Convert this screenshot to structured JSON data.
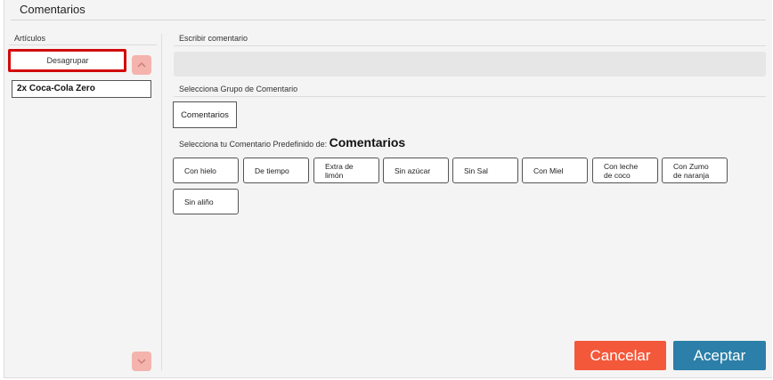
{
  "window": {
    "title": "Comentarios"
  },
  "left_panel": {
    "section_label": "Artículos",
    "ungroup_label": "Desagrupar",
    "articles": [
      {
        "label": "2x Coca-Cola Zero"
      }
    ],
    "scroll_up_icon": "chevron-up-icon",
    "scroll_down_icon": "chevron-down-icon"
  },
  "right_panel": {
    "write_label": "Escribir comentario",
    "comment_value": "",
    "group_label": "Selecciona Grupo de Comentario",
    "groups": [
      {
        "label": "Comentarios"
      }
    ],
    "predef_label": "Selecciona tu Comentario Predefinido de:",
    "predef_group": "Comentarios",
    "chips": [
      {
        "label": "Con hielo"
      },
      {
        "label": "De tiempo"
      },
      {
        "label": "Extra de\nlimón"
      },
      {
        "label": "Sin azúcar"
      },
      {
        "label": "Sin Sal"
      },
      {
        "label": "Con Miel"
      },
      {
        "label": "Con leche\nde coco"
      },
      {
        "label": "Con Zumo\nde naranja"
      },
      {
        "label": "Sin aliño"
      }
    ]
  },
  "footer": {
    "cancel_label": "Cancelar",
    "accept_label": "Aceptar"
  },
  "colors": {
    "cancel": "#f4583a",
    "accept": "#2b7fa8",
    "highlight": "#d20a0a",
    "scroll_button": "#f4b3ad"
  }
}
